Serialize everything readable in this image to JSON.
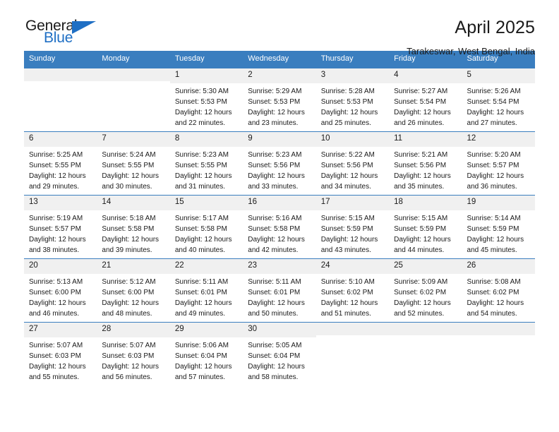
{
  "brand": {
    "name_part1": "General",
    "name_part2": "Blue",
    "triangle_icon": "triangle-icon",
    "accent_color": "#1f6fc4"
  },
  "header": {
    "title": "April 2025",
    "subtitle": "Tarakeswar, West Bengal, India"
  },
  "calendar": {
    "header_color": "#3a7ebf",
    "daynum_band_color": "#f0f0f0",
    "weekdays": [
      "Sunday",
      "Monday",
      "Tuesday",
      "Wednesday",
      "Thursday",
      "Friday",
      "Saturday"
    ],
    "labels": {
      "sunrise": "Sunrise:",
      "sunset": "Sunset:",
      "daylight": "Daylight:"
    },
    "weeks": [
      [
        {
          "day": "",
          "empty": true
        },
        {
          "day": "",
          "empty": true
        },
        {
          "day": "1",
          "sunrise": "Sunrise: 5:30 AM",
          "sunset": "Sunset: 5:53 PM",
          "daylight_l1": "Daylight: 12 hours",
          "daylight_l2": "and 22 minutes."
        },
        {
          "day": "2",
          "sunrise": "Sunrise: 5:29 AM",
          "sunset": "Sunset: 5:53 PM",
          "daylight_l1": "Daylight: 12 hours",
          "daylight_l2": "and 23 minutes."
        },
        {
          "day": "3",
          "sunrise": "Sunrise: 5:28 AM",
          "sunset": "Sunset: 5:53 PM",
          "daylight_l1": "Daylight: 12 hours",
          "daylight_l2": "and 25 minutes."
        },
        {
          "day": "4",
          "sunrise": "Sunrise: 5:27 AM",
          "sunset": "Sunset: 5:54 PM",
          "daylight_l1": "Daylight: 12 hours",
          "daylight_l2": "and 26 minutes."
        },
        {
          "day": "5",
          "sunrise": "Sunrise: 5:26 AM",
          "sunset": "Sunset: 5:54 PM",
          "daylight_l1": "Daylight: 12 hours",
          "daylight_l2": "and 27 minutes."
        }
      ],
      [
        {
          "day": "6",
          "sunrise": "Sunrise: 5:25 AM",
          "sunset": "Sunset: 5:55 PM",
          "daylight_l1": "Daylight: 12 hours",
          "daylight_l2": "and 29 minutes."
        },
        {
          "day": "7",
          "sunrise": "Sunrise: 5:24 AM",
          "sunset": "Sunset: 5:55 PM",
          "daylight_l1": "Daylight: 12 hours",
          "daylight_l2": "and 30 minutes."
        },
        {
          "day": "8",
          "sunrise": "Sunrise: 5:23 AM",
          "sunset": "Sunset: 5:55 PM",
          "daylight_l1": "Daylight: 12 hours",
          "daylight_l2": "and 31 minutes."
        },
        {
          "day": "9",
          "sunrise": "Sunrise: 5:23 AM",
          "sunset": "Sunset: 5:56 PM",
          "daylight_l1": "Daylight: 12 hours",
          "daylight_l2": "and 33 minutes."
        },
        {
          "day": "10",
          "sunrise": "Sunrise: 5:22 AM",
          "sunset": "Sunset: 5:56 PM",
          "daylight_l1": "Daylight: 12 hours",
          "daylight_l2": "and 34 minutes."
        },
        {
          "day": "11",
          "sunrise": "Sunrise: 5:21 AM",
          "sunset": "Sunset: 5:56 PM",
          "daylight_l1": "Daylight: 12 hours",
          "daylight_l2": "and 35 minutes."
        },
        {
          "day": "12",
          "sunrise": "Sunrise: 5:20 AM",
          "sunset": "Sunset: 5:57 PM",
          "daylight_l1": "Daylight: 12 hours",
          "daylight_l2": "and 36 minutes."
        }
      ],
      [
        {
          "day": "13",
          "sunrise": "Sunrise: 5:19 AM",
          "sunset": "Sunset: 5:57 PM",
          "daylight_l1": "Daylight: 12 hours",
          "daylight_l2": "and 38 minutes."
        },
        {
          "day": "14",
          "sunrise": "Sunrise: 5:18 AM",
          "sunset": "Sunset: 5:58 PM",
          "daylight_l1": "Daylight: 12 hours",
          "daylight_l2": "and 39 minutes."
        },
        {
          "day": "15",
          "sunrise": "Sunrise: 5:17 AM",
          "sunset": "Sunset: 5:58 PM",
          "daylight_l1": "Daylight: 12 hours",
          "daylight_l2": "and 40 minutes."
        },
        {
          "day": "16",
          "sunrise": "Sunrise: 5:16 AM",
          "sunset": "Sunset: 5:58 PM",
          "daylight_l1": "Daylight: 12 hours",
          "daylight_l2": "and 42 minutes."
        },
        {
          "day": "17",
          "sunrise": "Sunrise: 5:15 AM",
          "sunset": "Sunset: 5:59 PM",
          "daylight_l1": "Daylight: 12 hours",
          "daylight_l2": "and 43 minutes."
        },
        {
          "day": "18",
          "sunrise": "Sunrise: 5:15 AM",
          "sunset": "Sunset: 5:59 PM",
          "daylight_l1": "Daylight: 12 hours",
          "daylight_l2": "and 44 minutes."
        },
        {
          "day": "19",
          "sunrise": "Sunrise: 5:14 AM",
          "sunset": "Sunset: 5:59 PM",
          "daylight_l1": "Daylight: 12 hours",
          "daylight_l2": "and 45 minutes."
        }
      ],
      [
        {
          "day": "20",
          "sunrise": "Sunrise: 5:13 AM",
          "sunset": "Sunset: 6:00 PM",
          "daylight_l1": "Daylight: 12 hours",
          "daylight_l2": "and 46 minutes."
        },
        {
          "day": "21",
          "sunrise": "Sunrise: 5:12 AM",
          "sunset": "Sunset: 6:00 PM",
          "daylight_l1": "Daylight: 12 hours",
          "daylight_l2": "and 48 minutes."
        },
        {
          "day": "22",
          "sunrise": "Sunrise: 5:11 AM",
          "sunset": "Sunset: 6:01 PM",
          "daylight_l1": "Daylight: 12 hours",
          "daylight_l2": "and 49 minutes."
        },
        {
          "day": "23",
          "sunrise": "Sunrise: 5:11 AM",
          "sunset": "Sunset: 6:01 PM",
          "daylight_l1": "Daylight: 12 hours",
          "daylight_l2": "and 50 minutes."
        },
        {
          "day": "24",
          "sunrise": "Sunrise: 5:10 AM",
          "sunset": "Sunset: 6:02 PM",
          "daylight_l1": "Daylight: 12 hours",
          "daylight_l2": "and 51 minutes."
        },
        {
          "day": "25",
          "sunrise": "Sunrise: 5:09 AM",
          "sunset": "Sunset: 6:02 PM",
          "daylight_l1": "Daylight: 12 hours",
          "daylight_l2": "and 52 minutes."
        },
        {
          "day": "26",
          "sunrise": "Sunrise: 5:08 AM",
          "sunset": "Sunset: 6:02 PM",
          "daylight_l1": "Daylight: 12 hours",
          "daylight_l2": "and 54 minutes."
        }
      ],
      [
        {
          "day": "27",
          "sunrise": "Sunrise: 5:07 AM",
          "sunset": "Sunset: 6:03 PM",
          "daylight_l1": "Daylight: 12 hours",
          "daylight_l2": "and 55 minutes."
        },
        {
          "day": "28",
          "sunrise": "Sunrise: 5:07 AM",
          "sunset": "Sunset: 6:03 PM",
          "daylight_l1": "Daylight: 12 hours",
          "daylight_l2": "and 56 minutes."
        },
        {
          "day": "29",
          "sunrise": "Sunrise: 5:06 AM",
          "sunset": "Sunset: 6:04 PM",
          "daylight_l1": "Daylight: 12 hours",
          "daylight_l2": "and 57 minutes."
        },
        {
          "day": "30",
          "sunrise": "Sunrise: 5:05 AM",
          "sunset": "Sunset: 6:04 PM",
          "daylight_l1": "Daylight: 12 hours",
          "daylight_l2": "and 58 minutes."
        },
        {
          "day": "",
          "empty": true
        },
        {
          "day": "",
          "empty": true
        },
        {
          "day": "",
          "empty": true
        }
      ]
    ]
  }
}
